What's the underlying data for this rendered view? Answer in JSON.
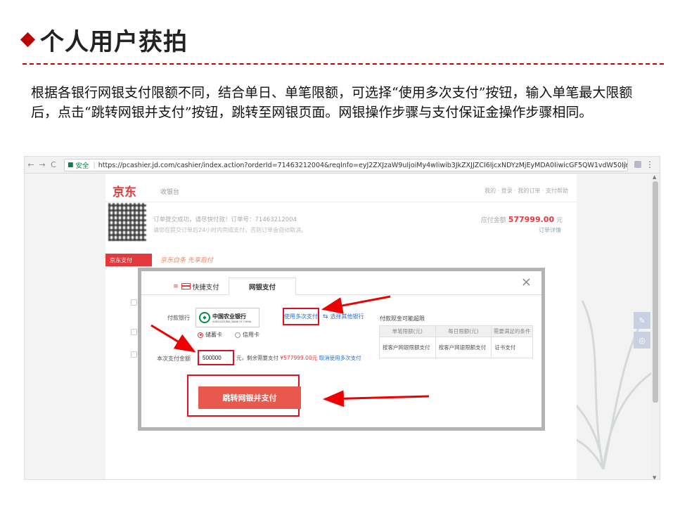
{
  "slide": {
    "title": "个人用户获拍",
    "paragraph": "根据各银行网银支付限额不同，结合单日、单笔限额，可选择“使用多次支付”按钮，输入单笔最大限额后，点击“跳转网银并支付”按钮，跳转至网银页面。网银操作步骤与支付保证金操作步骤相同。",
    "accent_color": "#c00000"
  },
  "browser": {
    "secure_label": "安全",
    "url": "https://pcashier.jd.com/cashier/index.action?orderId=71463212004&reqInfo=eyJ2ZXJzaW9uIjoiMy4wIiwib3JkZXJJZCI6IjcxNDYzMjEyMDA0IiwicGF5QW1vdW50Ijoi..."
  },
  "jd_page": {
    "logo": "京东",
    "cashier_label": "收银台",
    "header_links": "我的 · 登录 · 我的订单 · 支付帮助",
    "order_info": "订单提交成功，请尽快付款！订单号：71463212004",
    "order_info2": "请您在提交订单后24小时内完成支付，否则订单会自动取消。",
    "amount_prefix": "应付金额",
    "amount_value": "577999.00",
    "amount_suffix": "元",
    "detail_link": "订单详情",
    "badge": "京东支付",
    "slogan": "京东白条 先享后付"
  },
  "dialog": {
    "tab_quick": "快捷支付",
    "tab_netbank": "网银支付",
    "close": "×",
    "pay_bank_label": "付款银行",
    "bank_name_cn": "中国农业银行",
    "bank_name_en": "AGRICULTURAL BANK OF CHINA",
    "multi_pay": "使用多次支付",
    "other_bank": "选择其他银行",
    "card_debit": "储蓄卡",
    "card_credit": "信用卡",
    "amount_label": "本次支付金额",
    "amount_input": "500000",
    "unit": "元，剩余需要支付",
    "remaining": "¥577999.00元",
    "cancel_multi": "取消使用多次支付",
    "limit_title": "付款现金可能超限",
    "limit_headers": [
      "单笔限额(元)",
      "每日限额(元)",
      "需要满足的条件"
    ],
    "limit_row": [
      "按客户网银限额支付",
      "按客户网银限额支付",
      "证书支付"
    ],
    "pay_button": "跳转网银并支付"
  }
}
